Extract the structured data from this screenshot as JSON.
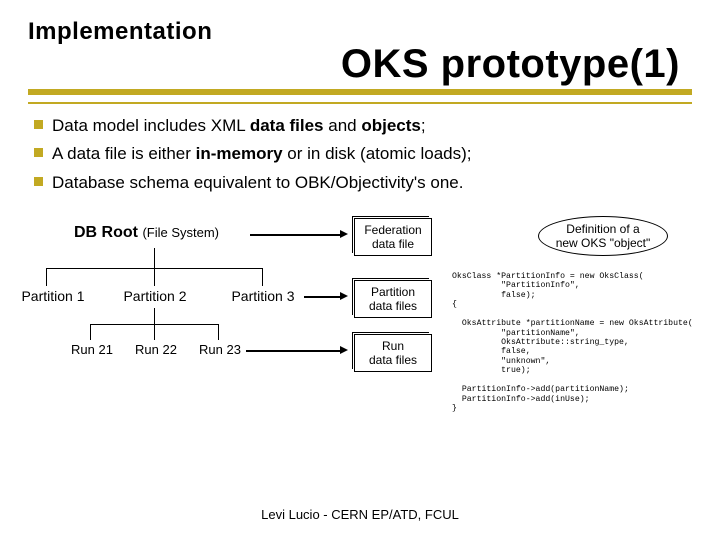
{
  "header": {
    "kicker": "Implementation",
    "title": "OKS prototype(1)"
  },
  "bullets": [
    {
      "pre": "Data model includes XML ",
      "b1": "data files",
      "mid": " and ",
      "b2": "objects",
      "post": ";"
    },
    {
      "pre": "A data file is either ",
      "b1": "in-memory",
      "mid": " or in disk (atomic loads);",
      "b2": "",
      "post": ""
    },
    {
      "pre": "Database schema equivalent to OBK/Objectivity's one.",
      "b1": "",
      "mid": "",
      "b2": "",
      "post": ""
    }
  ],
  "diagram": {
    "db_root": "DB Root",
    "db_root_note": "(File System)",
    "partitions": [
      "Partition 1",
      "Partition 2",
      "Partition 3"
    ],
    "runs": [
      "Run 21",
      "Run 22",
      "Run 23"
    ],
    "fed_box": "Federation\ndata file",
    "part_box": "Partition\ndata files",
    "run_box": "Run\ndata files",
    "oval": "Definition of a\nnew OKS \"object\""
  },
  "code": "OksClass *PartitionInfo = new OksClass(\n          \"PartitionInfo\",\n          false);\n{\n\n  OksAttribute *partitionName = new OksAttribute(\n          \"partitionName\",\n          OksAttribute::string_type,\n          false,\n          \"unknown\",\n          true);\n\n  PartitionInfo->add(partitionName);\n  PartitionInfo->add(inUse);\n}",
  "footer": "Levi Lucio - CERN EP/ATD, FCUL"
}
